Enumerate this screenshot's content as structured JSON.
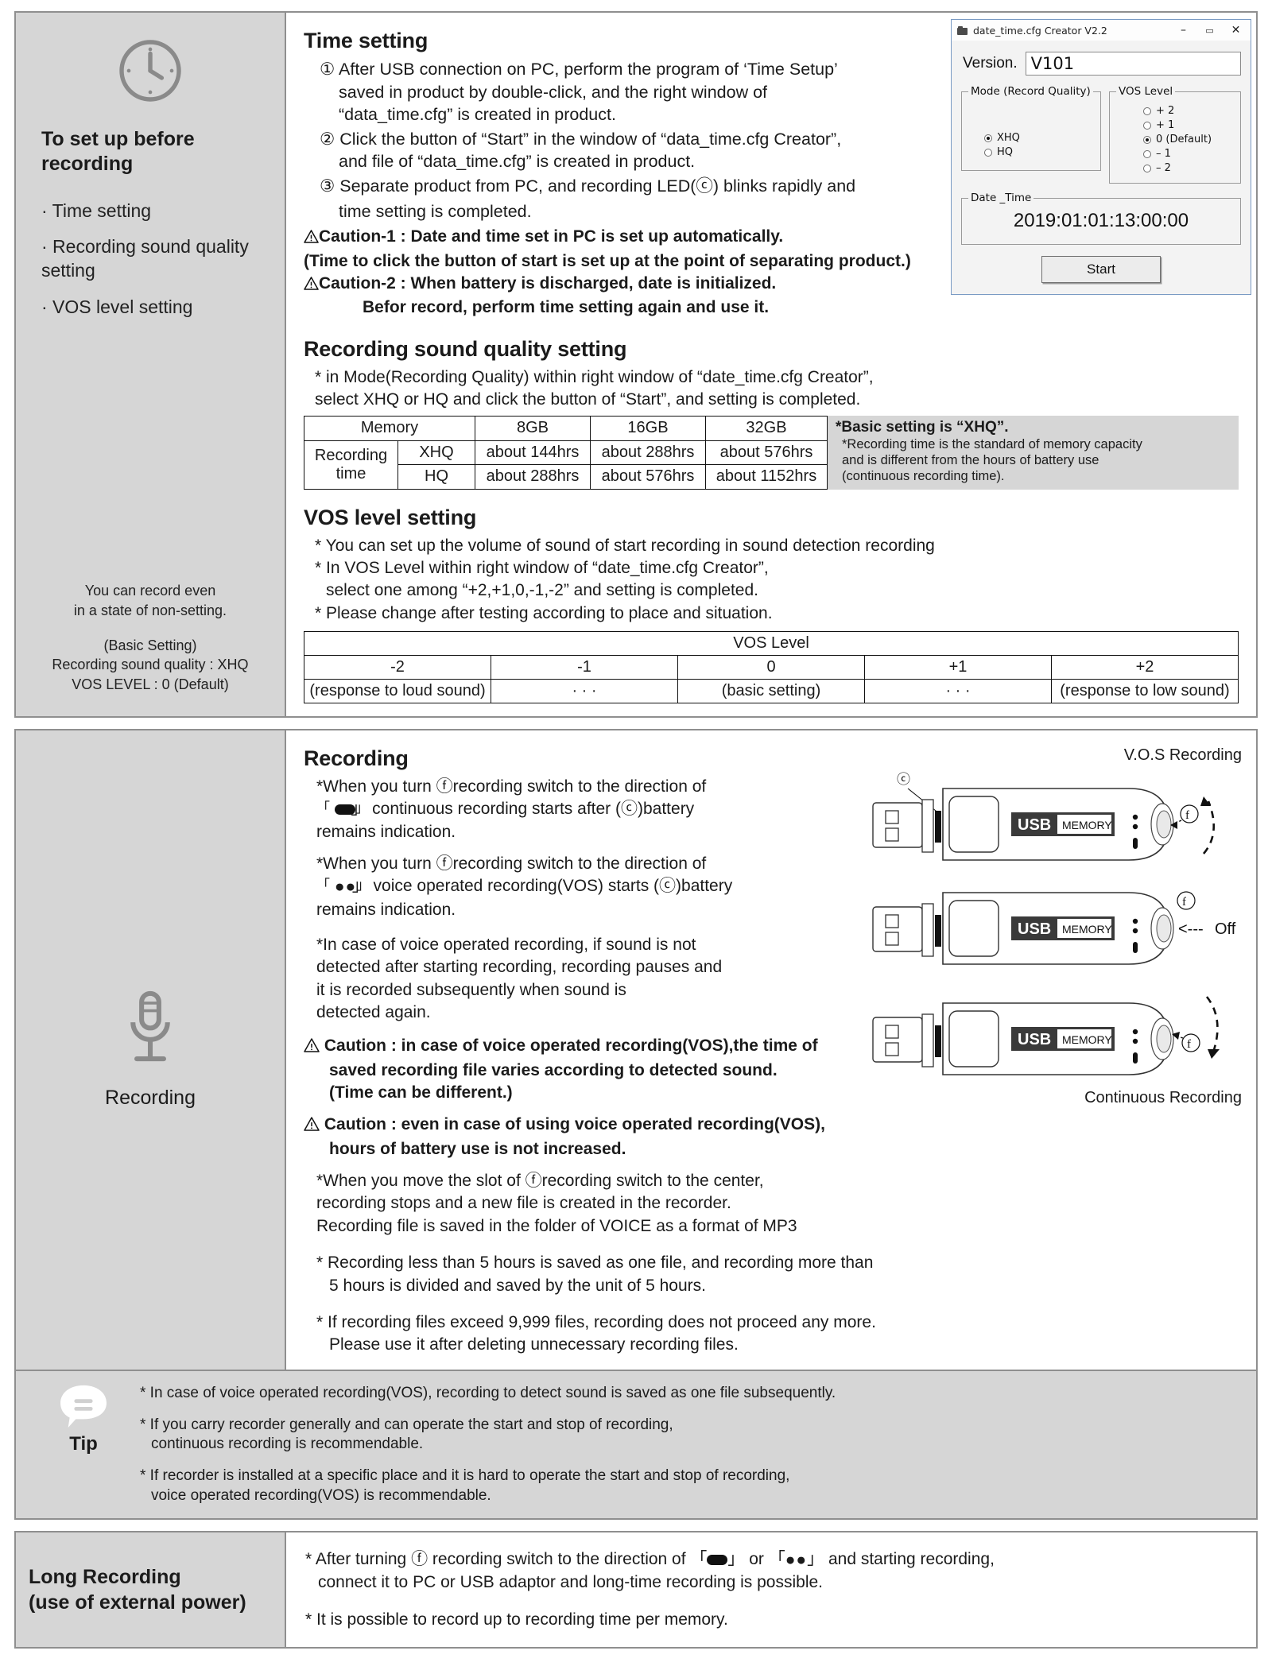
{
  "section1": {
    "side": {
      "icon": "clock-icon",
      "title": "To set up before recording",
      "items": [
        "· Time setting",
        "· Recording sound quality setting",
        "· VOS level setting"
      ],
      "note_line1": "You can record even",
      "note_line2": "in a state of non-setting.",
      "note_line3": "(Basic Setting)",
      "note_line4": "Recording sound quality : XHQ",
      "note_line5": "VOS LEVEL : 0 (Default)"
    },
    "time_setting": {
      "heading": "Time setting",
      "step1_a": "① After USB connection on PC, perform the program of ‘Time Setup’",
      "step1_b": "saved in product by double-click, and the right window of",
      "step1_c": "“data_time.cfg” is created in product.",
      "step2_a": "② Click the button of “Start” in the window of “data_time.cfg Creator”,",
      "step2_b": "and file of “data_time.cfg” is created in product.",
      "step3_a": "③ Separate product from PC, and recording LED(ⓒ) blinks rapidly and",
      "step3_b": "time setting is completed.",
      "caution1_a": "Caution-1 : Date and time set in PC is set up automatically.",
      "caution1_b": "(Time to click the button of start is set up at the point of separating product.)",
      "caution2_a": "Caution-2 : When battery is discharged, date is initialized.",
      "caution2_b": "Befor record, perform time setting again and use it."
    },
    "dialog": {
      "title": "date_time.cfg Creator V2.2",
      "minimize": "–",
      "maximize": "▭",
      "close": "✕",
      "version_label": "Version.",
      "version_value": "V101",
      "mode_legend": "Mode (Record Quality)",
      "mode_options": [
        {
          "label": "XHQ",
          "selected": true
        },
        {
          "label": "HQ",
          "selected": false
        }
      ],
      "vos_legend": "VOS Level",
      "vos_options": [
        {
          "label": "+ 2",
          "selected": false
        },
        {
          "label": "+ 1",
          "selected": false
        },
        {
          "label": "0 (Default)",
          "selected": true
        },
        {
          "label": "– 1",
          "selected": false
        },
        {
          "label": "– 2",
          "selected": false
        }
      ],
      "date_legend": "Date _Time",
      "date_value": "2019:01:01:13:00:00",
      "start_label": "Start"
    },
    "sound_quality": {
      "heading": "Recording sound quality setting",
      "line1": "* in Mode(Recording Quality) within right window of “date_time.cfg Creator”,",
      "line2": "select XHQ or HQ and click the button of “Start”, and setting is completed.",
      "table": {
        "header": [
          "Memory",
          "8GB",
          "16GB",
          "32GB"
        ],
        "row_label": "Recording time",
        "rows": [
          {
            "mode": "XHQ",
            "values": [
              "about 144hrs",
              "about 288hrs",
              "about 576hrs"
            ]
          },
          {
            "mode": "HQ",
            "values": [
              "about 288hrs",
              "about 576hrs",
              "about 1152hrs"
            ]
          }
        ]
      },
      "note_bold": "*Basic setting is “XHQ”.",
      "note_line1": "*Recording time is the standard of memory capacity",
      "note_line2": "and is different from the hours of battery use",
      "note_line3": "(continuous recording time)."
    },
    "vos_setting": {
      "heading": "VOS level setting",
      "line1": "* You can set up the volume of sound of start recording in sound detection recording",
      "line2": "* In VOS Level within right window of “date_time.cfg Creator”,",
      "line3": "select one among “+2,+1,0,-1,-2” and setting is completed.",
      "line4": "* Please change after testing according to place and situation.",
      "table": {
        "title": "VOS Level",
        "levels": [
          "-2",
          "-1",
          "0",
          "+1",
          "+2"
        ],
        "descriptions": [
          "(response to loud sound)",
          "· · ·",
          "(basic setting)",
          "· · ·",
          "(response to low sound)"
        ]
      }
    }
  },
  "section2": {
    "side": {
      "icon": "microphone-icon",
      "title": "Recording"
    },
    "heading": "Recording",
    "paragraphs": {
      "p1_l1": "*When you turn ⓕrecording switch to the direction of",
      "p1_l2_pre": "「",
      "p1_l2_post": "」 continuous recording starts after (ⓒ)battery",
      "p1_l3": "remains indication.",
      "p2_l1": "*When you turn ⓕrecording switch to the direction of",
      "p2_l2_pre": "「",
      "p2_l2_post": "」 voice operated recording(VOS) starts (ⓒ)battery",
      "p2_l3": "remains indication.",
      "p3_l1": "*In case of voice operated recording, if sound is not",
      "p3_l2": "detected after starting recording, recording pauses and",
      "p3_l3": "it is recorded subsequently when sound is",
      "p3_l4": "detected again.",
      "c1_l1": "Caution : in case of voice operated recording(VOS),the time of",
      "c1_l2": "saved recording file varies according to detected sound.",
      "c1_l3": "(Time can be different.)",
      "c2_l1": "Caution : even in case of using voice operated recording(VOS),",
      "c2_l2": "hours of battery use is not increased.",
      "p4_l1": "*When you move the slot of ⓕrecording switch to the center,",
      "p4_l2": "recording stops and a new file is created in the recorder.",
      "p4_l3": "Recording file is saved in the folder of VOICE as a format of MP3",
      "p5_l1": "* Recording less than 5 hours is saved as one file, and recording more than",
      "p5_l2": "5 hours is divided and saved by the unit of 5 hours.",
      "p6_l1": "* If recording files exceed 9,999 files, recording does not proceed any more.",
      "p6_l2": "Please use it after deleting unnecessary recording files."
    },
    "illustrations": {
      "usb_label_bold": "USB",
      "usb_label_light": "MEMORY",
      "caption_top": "V.O.S Recording",
      "marker_c": "ⓒ",
      "marker_f": "ⓕ",
      "caption_mid": "Off",
      "caption_mid_arrow": "←---",
      "caption_bottom": "Continuous Recording"
    },
    "tip": {
      "word": "Tip",
      "items": [
        "* In case of voice operated recording(VOS), recording to detect sound is saved as one file subsequently.",
        "* If you carry recorder generally and can operate the start and stop of recording,\n   continuous recording is recommendable.",
        "* If recorder is installed at a specific place and it is hard to operate the start and stop of recording,\n   voice operated recording(VOS) is recommendable."
      ],
      "item1": "* In case of voice operated recording(VOS), recording to detect sound is saved as one file subsequently.",
      "item2_l1": "* If you carry recorder generally and can operate the start and stop of recording,",
      "item2_l2": "continuous recording is recommendable.",
      "item3_l1": "* If recorder is installed at a specific place and it is hard to operate the start and stop of recording,",
      "item3_l2": "voice operated recording(VOS) is recommendable."
    }
  },
  "section3": {
    "title_l1": "Long Recording",
    "title_l2": "(use of external power)",
    "item1_pre": "* After turning ⓕ recording switch to the direction of 「",
    "item1_mid": "」 or 「",
    "item1_post": "」 and starting recording,",
    "item1_l2": "connect it to PC or USB adaptor and long-time recording is possible.",
    "item2": "* It is possible to record up to recording time per memory."
  },
  "colors": {
    "sidebar_bg": "#d6d6d6",
    "border": "#8f8f8f",
    "text": "#1b1b1b",
    "dialog_border": "#7a9bc4"
  }
}
